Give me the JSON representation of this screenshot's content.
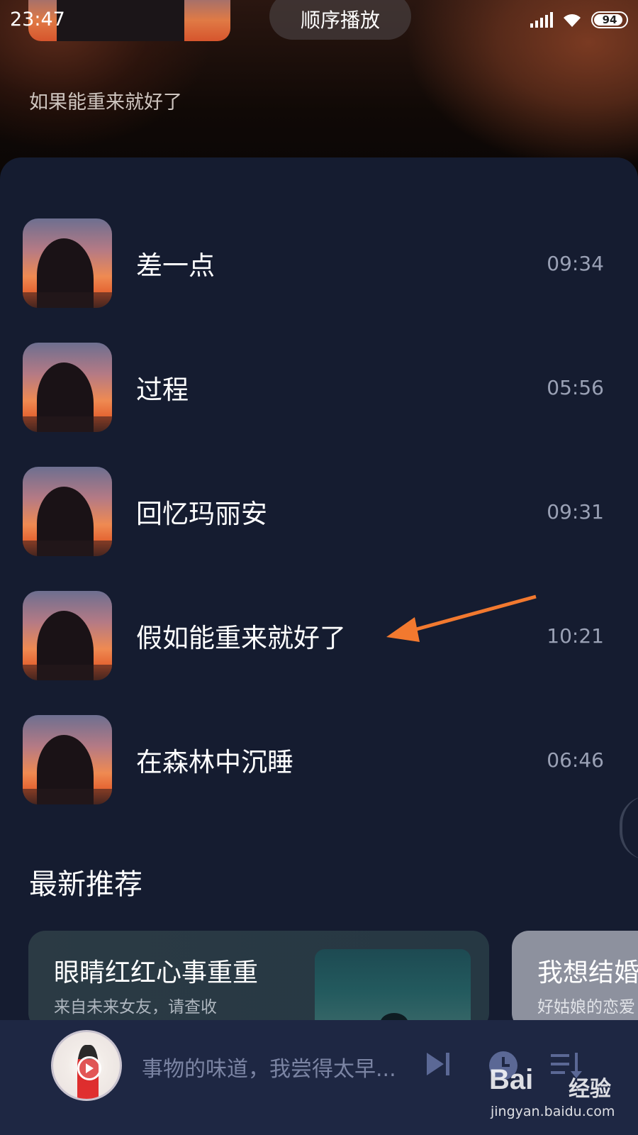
{
  "status_bar": {
    "time": "23:47",
    "battery": "94"
  },
  "header": {
    "play_mode": "顺序播放",
    "current_lyric": "如果能重来就好了"
  },
  "playlist": [
    {
      "title": "差一点",
      "duration": "09:34"
    },
    {
      "title": "过程",
      "duration": "05:56"
    },
    {
      "title": "回忆玛丽安",
      "duration": "09:31"
    },
    {
      "title": "假如能重来就好了",
      "duration": "10:21"
    },
    {
      "title": "在森林中沉睡",
      "duration": "06:46"
    }
  ],
  "recommend": {
    "title": "最新推荐",
    "cards": [
      {
        "title": "眼睛红红心事重重",
        "subtitle": "来自未来女友，请查收"
      },
      {
        "title": "我想结婚",
        "subtitle": "好姑娘的恋爱"
      }
    ]
  },
  "player": {
    "now_playing_text": "事物的味道，我尝得太早..."
  },
  "watermark": {
    "logo": "Bai",
    "logo2": "经验",
    "url": "jingyan.baidu.com"
  },
  "colors": {
    "panel": "#151c30",
    "player": "#1e2743",
    "arrow": "#f2792f"
  },
  "icons": [
    "signal-icon",
    "wifi-icon",
    "battery-icon",
    "play-icon",
    "next-icon",
    "timer-icon",
    "playlist-icon"
  ]
}
